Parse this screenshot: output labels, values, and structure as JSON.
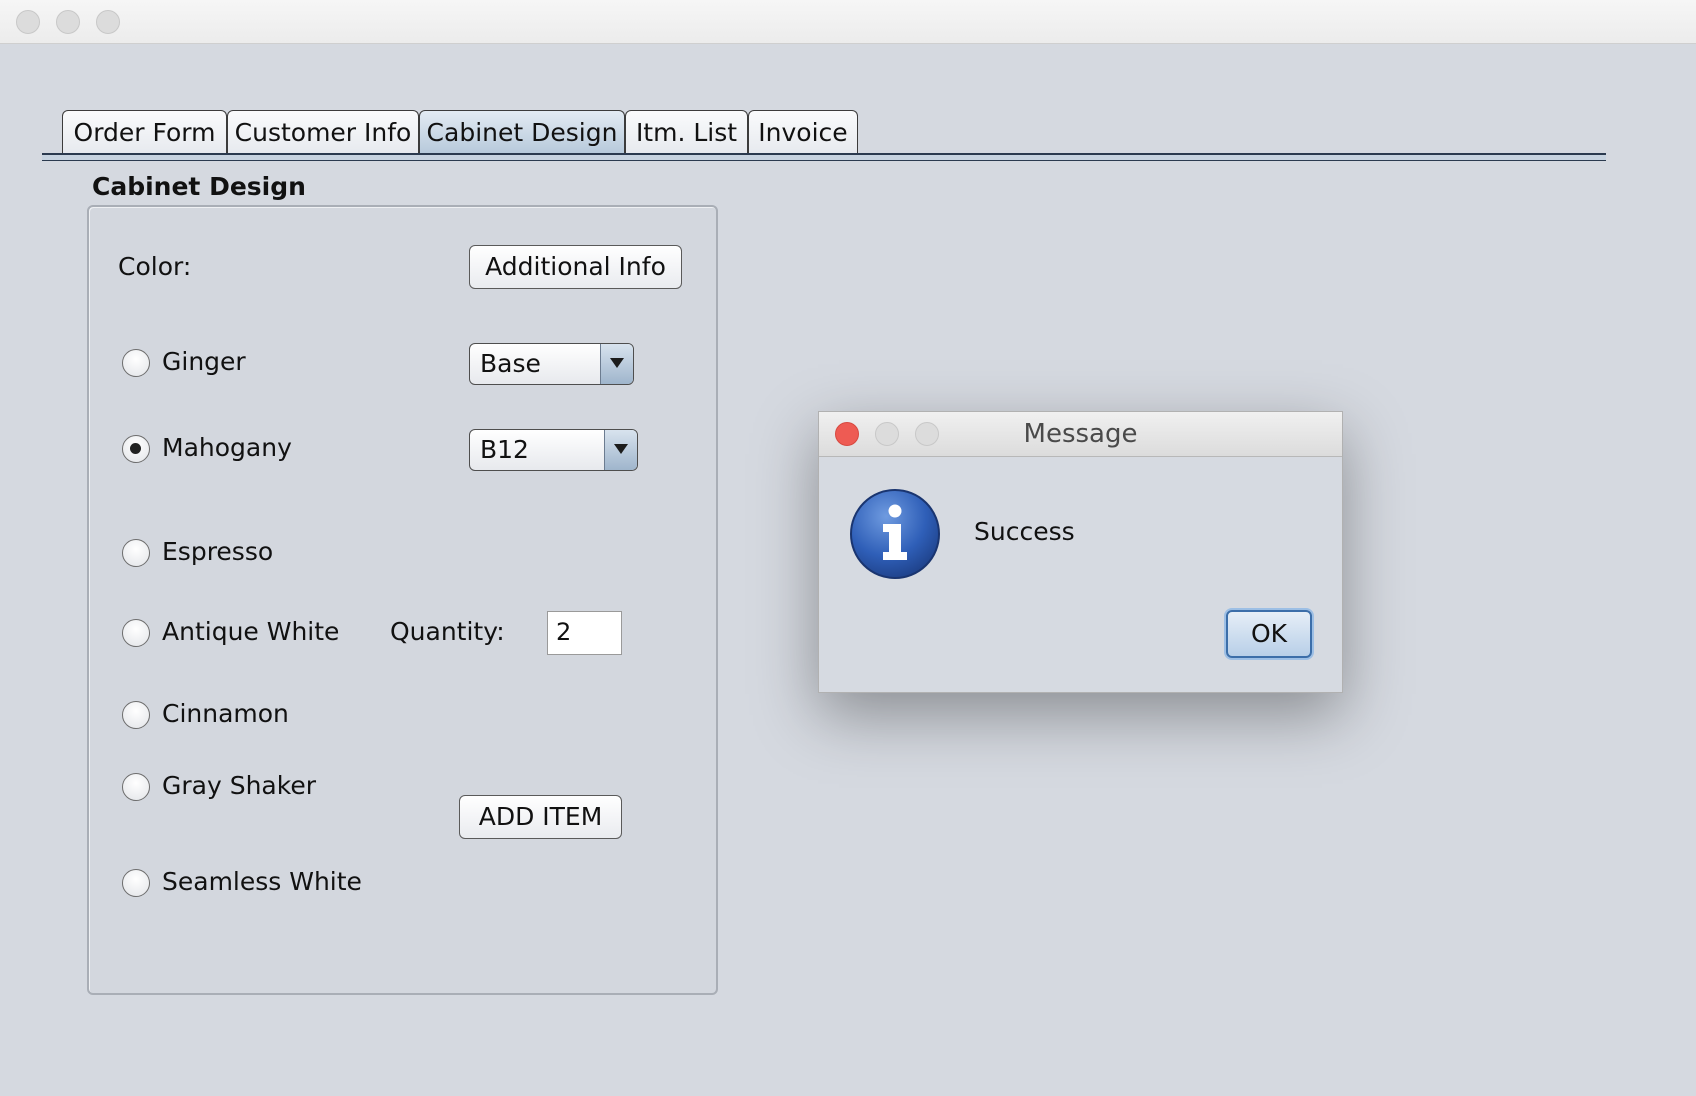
{
  "window": {
    "traffic_lights": [
      "close",
      "minimize",
      "zoom"
    ]
  },
  "tabs": [
    {
      "label": "Order Form"
    },
    {
      "label": "Customer Info"
    },
    {
      "label": "Cabinet Design",
      "active": true
    },
    {
      "label": "Itm. List"
    },
    {
      "label": "Invoice"
    }
  ],
  "section": {
    "title": "Cabinet Design",
    "color_label": "Color:",
    "additional_info_button": "Additional Info",
    "colors": [
      {
        "label": "Ginger",
        "selected": false
      },
      {
        "label": "Mahogany",
        "selected": true
      },
      {
        "label": "Espresso",
        "selected": false
      },
      {
        "label": "Antique White",
        "selected": false
      },
      {
        "label": "Cinnamon",
        "selected": false
      },
      {
        "label": "Gray Shaker",
        "selected": false
      },
      {
        "label": "Seamless White",
        "selected": false
      }
    ],
    "type_combo": {
      "value": "Base"
    },
    "model_combo": {
      "value": "B12"
    },
    "quantity_label": "Quantity:",
    "quantity_value": "2",
    "add_item_button": "ADD ITEM"
  },
  "dialog": {
    "title": "Message",
    "message": "Success",
    "ok_button": "OK",
    "icon": "info-icon",
    "close_color": "#ee5b53"
  },
  "colors": {
    "background": "#d5d9e0",
    "active_tab": "#b5c8da",
    "default_button_border": "#3c6ea9"
  }
}
